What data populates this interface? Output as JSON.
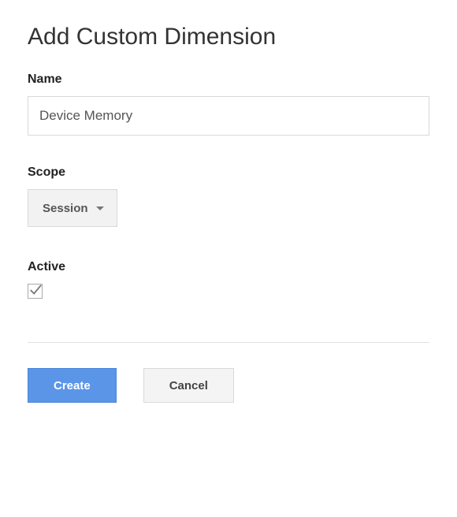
{
  "title": "Add Custom Dimension",
  "fields": {
    "name": {
      "label": "Name",
      "value": "Device Memory"
    },
    "scope": {
      "label": "Scope",
      "selected": "Session"
    },
    "active": {
      "label": "Active",
      "checked": true
    }
  },
  "buttons": {
    "create": "Create",
    "cancel": "Cancel"
  }
}
